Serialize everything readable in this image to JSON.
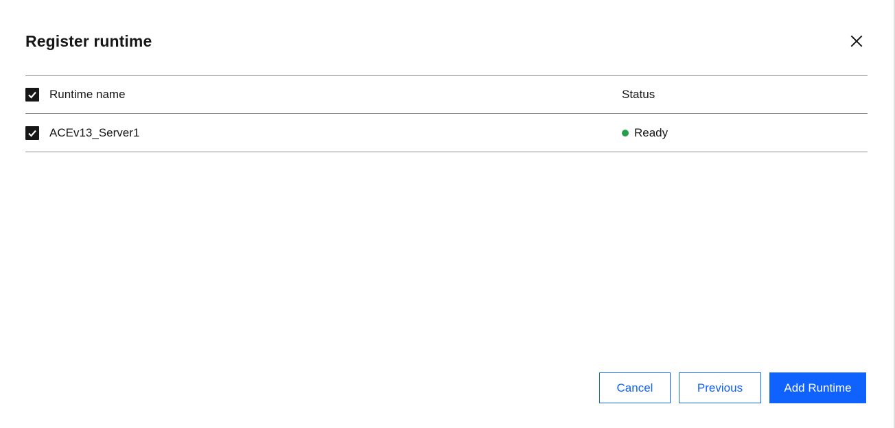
{
  "modal": {
    "title": "Register runtime",
    "close_icon": "close-icon"
  },
  "table": {
    "headers": {
      "name": "Runtime name",
      "status": "Status"
    },
    "header_checkbox_checked": true,
    "rows": [
      {
        "name": "ACEv13_Server1",
        "status": "Ready",
        "checked": true,
        "status_color": "#24a148"
      }
    ]
  },
  "footer": {
    "cancel_label": "Cancel",
    "previous_label": "Previous",
    "add_label": "Add Runtime"
  },
  "colors": {
    "primary": "#0f62fe",
    "text": "#161616",
    "divider": "#8d8d8d",
    "ready": "#24a148"
  }
}
